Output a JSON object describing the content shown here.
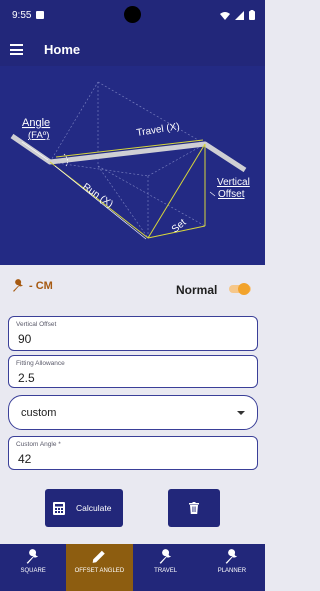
{
  "status": {
    "time": "9:55",
    "icons": [
      "notification-icon",
      "wifi-icon",
      "signal-icon",
      "battery-icon"
    ]
  },
  "app_bar": {
    "title": "Home"
  },
  "diagram": {
    "labels": {
      "angle_line1": "Angle",
      "angle_line2": "(FAº)",
      "travel": "Travel (X)",
      "vertical_line1": "Vertical",
      "vertical_line2": "Offset",
      "run": "Run (X)",
      "set": "Set"
    }
  },
  "units": {
    "label": "- CM",
    "mode": "Normal",
    "toggle_on": true
  },
  "fields": {
    "vertical_offset": {
      "label": "Vertical Offset",
      "value": "90"
    },
    "fitting_allowance": {
      "label": "Fitting Allowance",
      "value": "2.5"
    },
    "angle_select": {
      "value": "custom"
    },
    "custom_angle": {
      "label": "Custom Angle *",
      "value": "42"
    }
  },
  "actions": {
    "calculate": "Calculate"
  },
  "nav": {
    "items": [
      {
        "label": "SQUARE",
        "icon": "wrench-icon",
        "active": false
      },
      {
        "label": "OFFSET ANGLED",
        "icon": "pencil-icon",
        "active": true
      },
      {
        "label": "TRAVEL",
        "icon": "wrench-icon",
        "active": false
      },
      {
        "label": "PLANNER",
        "icon": "wrench-icon",
        "active": false
      }
    ]
  },
  "colors": {
    "primary": "#22277a",
    "accent": "#f2a32c",
    "active_tab": "#8d5d10",
    "unit_label": "#a65a12"
  }
}
